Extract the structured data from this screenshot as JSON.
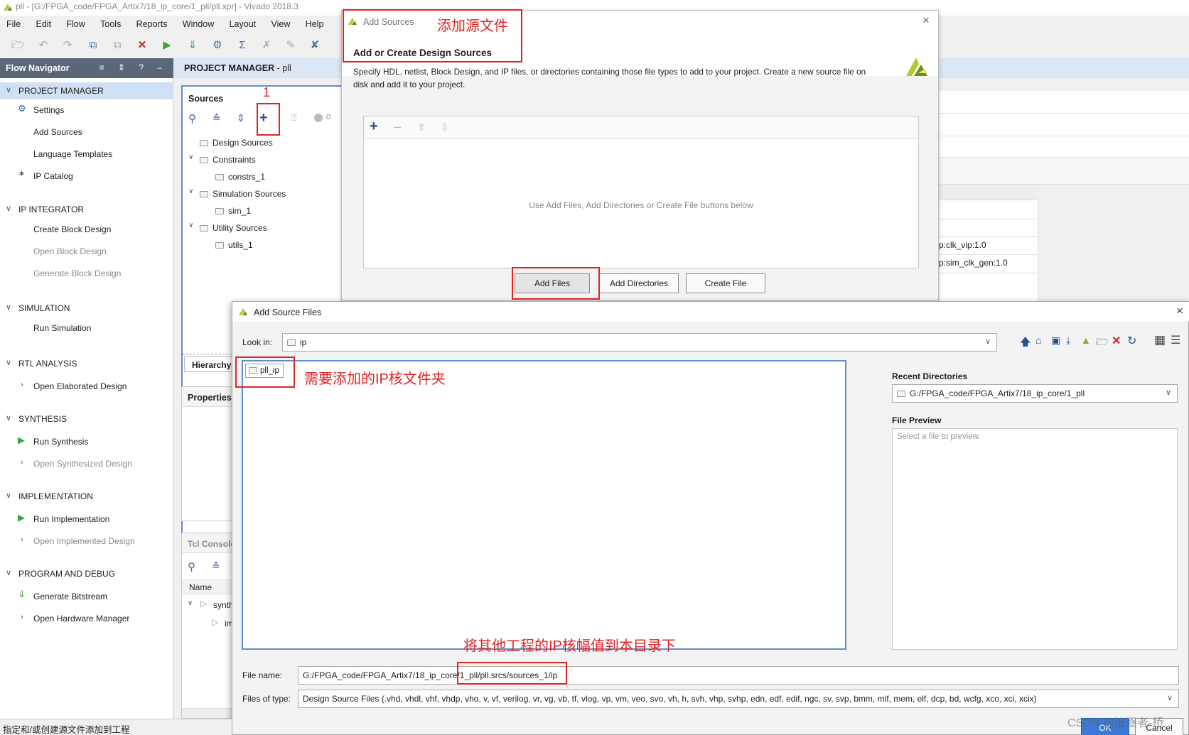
{
  "window": {
    "title": "pll - [G:/FPGA_code/FPGA_Artix7/18_ip_core/1_pll/pll.xpr] - Vivado 2018.3"
  },
  "menu": [
    "File",
    "Edit",
    "Flow",
    "Tools",
    "Reports",
    "Window",
    "Layout",
    "View",
    "Help"
  ],
  "flow_navigator": {
    "title": "Flow Navigator",
    "controls": "≡ ⇕ ? –",
    "sections": [
      {
        "label": "PROJECT MANAGER",
        "items": [
          "Settings",
          "Add Sources",
          "Language Templates",
          "IP Catalog"
        ]
      },
      {
        "label": "IP INTEGRATOR",
        "items": [
          "Create Block Design",
          "Open Block Design",
          "Generate Block Design"
        ]
      },
      {
        "label": "SIMULATION",
        "items": [
          "Run Simulation"
        ]
      },
      {
        "label": "RTL ANALYSIS",
        "items": [
          "Open Elaborated Design"
        ]
      },
      {
        "label": "SYNTHESIS",
        "items": [
          "Run Synthesis",
          "Open Synthesized Design"
        ]
      },
      {
        "label": "IMPLEMENTATION",
        "items": [
          "Run Implementation",
          "Open Implemented Design"
        ]
      },
      {
        "label": "PROGRAM AND DEBUG",
        "items": [
          "Generate Bitstream",
          "Open Hardware Manager"
        ]
      }
    ]
  },
  "project_manager": {
    "title": "PROJECT MANAGER",
    "project": "- pll"
  },
  "sources": {
    "title": "Sources",
    "badge_count": "0",
    "tree": [
      "Design Sources",
      "Constraints",
      "constrs_1",
      "Simulation Sources",
      "sim_1",
      "Utility Sources",
      "utils_1"
    ],
    "hierarchy_tab": "Hierarchy"
  },
  "properties": {
    "title": "Properties"
  },
  "tcl": {
    "title": "Tcl Console",
    "col_name": "Name",
    "row1": "synth",
    "row2": "im"
  },
  "background_table": {
    "row1": "p:clk_vip:1.0",
    "row2": "p:sim_clk_gen:1.0"
  },
  "add_sources": {
    "title": "Add Sources",
    "heading": "Add or Create Design Sources",
    "description": "Specify HDL, netlist, Block Design, and IP files, or directories containing those file types to add to your project. Create a new source file on disk and add it to your project.",
    "empty_hint": "Use Add Files, Add Directories or Create File buttons below",
    "buttons": {
      "add_files": "Add Files",
      "add_dirs": "Add Directories",
      "create_file": "Create File"
    }
  },
  "add_source_files": {
    "title": "Add Source Files",
    "look_in_label": "Look in:",
    "look_in_value": "ip",
    "folder_item": "pll_ip",
    "recent_dirs_label": "Recent Directories",
    "recent_dir_value": "G:/FPGA_code/FPGA_Artix7/18_ip_core/1_pll",
    "file_preview_label": "File Preview",
    "file_preview_hint": "Select a file to preview.",
    "file_name_label": "File name:",
    "file_name_value": "G:/FPGA_code/FPGA_Artix7/18_ip_core/1_pll/pll.srcs/sources_1/ip",
    "files_of_type_label": "Files of type:",
    "files_of_type_value": "Design Source Files (.vhd, vhdl, vhf, vhdp, vho, v, vf, verilog, vr, vg, vb, tf, vlog, vp, vm, veo, svo, vh, h, svh, vhp, svhp, edn, edf, edif, ngc, sv, svp, bmm, mif, mem, elf, dcp, bd, wcfg, xco, xci, xcix)",
    "ok": "OK",
    "cancel": "Cancel"
  },
  "annotations": {
    "add_source_file": "添加源文件",
    "step1": "1",
    "ip_folder": "需要添加的IP核文件夹",
    "copy_ip": "将其他工程的IP核幅值到本目录下"
  },
  "status_bar": "指定和/或创建源文件添加到工程",
  "watermark": "CSDN @追逐者-桥",
  "colors": {
    "accent_blue": "#5b8fd0",
    "annotation_red": "#e02424",
    "nav_header": "#5a6777",
    "run_green": "#3aa63a"
  }
}
